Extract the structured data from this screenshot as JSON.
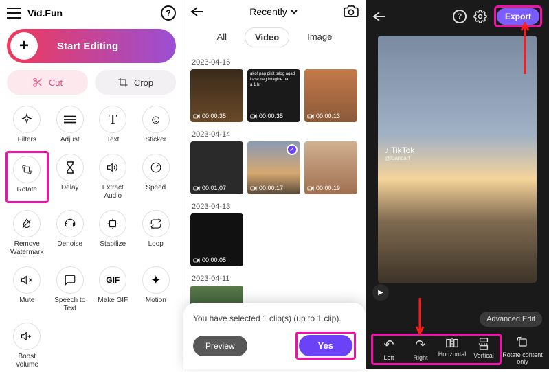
{
  "panel1": {
    "title": "Vid.Fun",
    "start_label": "Start Editing",
    "cut_label": "Cut",
    "crop_label": "Crop",
    "tools": [
      {
        "label": "Filters"
      },
      {
        "label": "Adjust"
      },
      {
        "label": "Text"
      },
      {
        "label": "Sticker"
      },
      {
        "label": "Rotate"
      },
      {
        "label": "Delay"
      },
      {
        "label": "Extract\nAudio"
      },
      {
        "label": "Speed"
      },
      {
        "label": "Remove\nWatermark"
      },
      {
        "label": "Denoise"
      },
      {
        "label": "Stabilize"
      },
      {
        "label": "Loop"
      },
      {
        "label": "Mute"
      },
      {
        "label": "Speech to\nText"
      },
      {
        "label": "Make GIF"
      },
      {
        "label": "Motion"
      },
      {
        "label": "Boost\nVolume"
      }
    ]
  },
  "panel2": {
    "sort_label": "Recently",
    "tabs": {
      "all": "All",
      "video": "Video",
      "image": "Image"
    },
    "dates": [
      "2023-04-16",
      "2023-04-14",
      "2023-04-13",
      "2023-04-11"
    ],
    "durations": {
      "d0": [
        "00:00:35",
        "00:00:35",
        "00:00:13"
      ],
      "d1": [
        "00:01:07",
        "00:00:17",
        "00:00:19"
      ],
      "d2": [
        "00:00:05"
      ]
    },
    "sheet_text": "You have selected 1 clip(s) (up to 1 clip).",
    "preview_label": "Preview",
    "yes_label": "Yes"
  },
  "panel3": {
    "export_label": "Export",
    "watermark_user": "TikTok",
    "watermark_handle": "@loancart",
    "adv_label": "Advanced Edit",
    "tools": {
      "left": "Left",
      "right": "Right",
      "horizontal": "Horizontal",
      "vertical": "Vertical",
      "rotate_only": "Rotate content only"
    }
  }
}
